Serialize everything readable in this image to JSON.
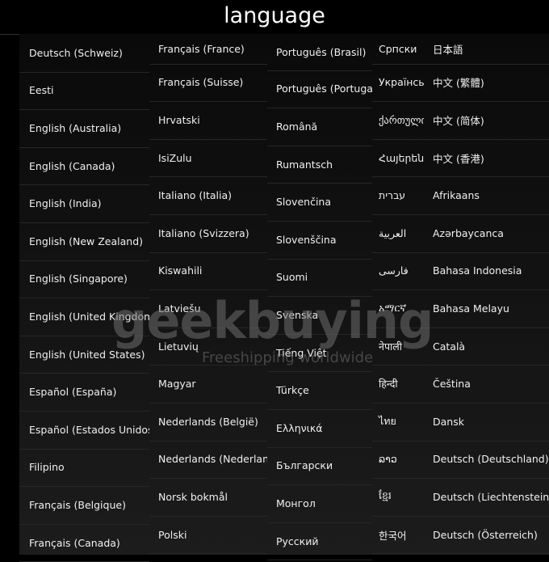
{
  "header": {
    "title": "language"
  },
  "columns": [
    [
      "Deutsch (Schweiz)",
      "Eesti",
      "English (Australia)",
      "English (Canada)",
      "English (India)",
      "English (New Zealand)",
      "English (Singapore)",
      "English (United Kingdom)",
      "English (United States)",
      "Español (España)",
      "Español (Estados Unidos)",
      "Filipino",
      "Français (Belgique)",
      "Français (Canada)"
    ],
    [
      "Français (France)",
      "Français (Suisse)",
      "Hrvatski",
      "IsiZulu",
      "Italiano (Italia)",
      "Italiano (Svizzera)",
      "Kiswahili",
      "Latviešu",
      "Lietuvių",
      "Magyar",
      "Nederlands (België)",
      "Nederlands (Nederland)",
      "Norsk bokmål",
      "Polski"
    ],
    [
      "Português (Brasil)",
      "Português (Portugal)",
      "Română",
      "Rumantsch",
      "Slovenčina",
      "Slovenščina",
      "Suomi",
      "Svenska",
      "Tiếng Việt",
      "Türkçe",
      "Ελληνικά",
      "Български",
      "Монгол",
      "Русский"
    ],
    [
      "Српски",
      "Українська",
      "ქართული",
      "Հայերեն",
      "עברית",
      "العربية",
      "فارسی",
      "አማርኛ",
      "नेपाली",
      "हिन्दी",
      "ไทย",
      "ລາວ",
      "ខ្មែរ",
      "한국어"
    ],
    [
      "日本語",
      "中文 (繁體)",
      "中文 (简体)",
      "中文 (香港)",
      "Afrikaans",
      "Azərbaycanca",
      "Bahasa Indonesia",
      "Bahasa Melayu",
      "Català",
      "Čeština",
      "Dansk",
      "Deutsch (Deutschland)",
      "Deutsch (Liechtenstein)",
      "Deutsch (Österreich)"
    ]
  ],
  "watermark": {
    "logo": "geekbuying",
    "tagline": "Freeshipping worldwide"
  }
}
